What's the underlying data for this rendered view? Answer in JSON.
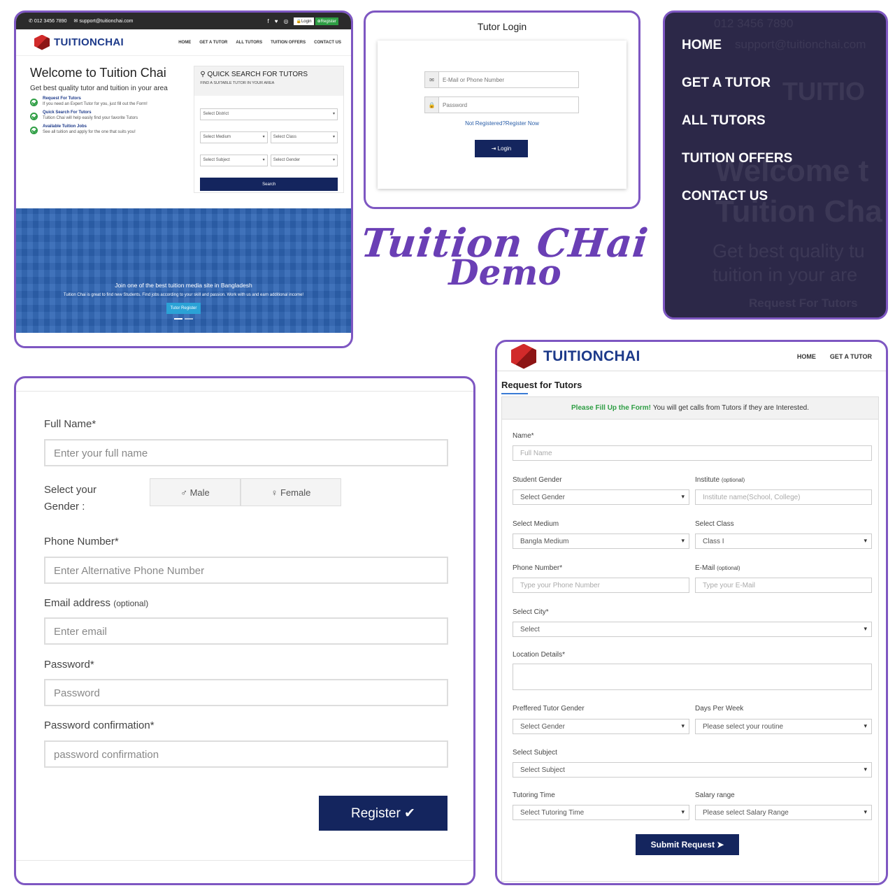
{
  "home": {
    "phone": "012 3456 7890",
    "email": "support@tuitionchai.com",
    "social": [
      "f",
      "♥",
      "◎"
    ],
    "login": "Login",
    "register": "Register",
    "brand": "TUITIONCHAI",
    "nav": [
      "HOME",
      "GET A TUTOR",
      "ALL TUTORS",
      "TUITION OFFERS",
      "CONTACT US"
    ],
    "title": "Welcome to Tuition Chai",
    "subtitle": "Get best quality tutor and tuition in your area",
    "features": [
      {
        "title": "Request For Tutors",
        "desc": "If you need an Expert Tutor for you, just fill out the Form!"
      },
      {
        "title": "Quick Search For Tutors",
        "desc": "Tuition Chai will help easily find your favorite Tutors"
      },
      {
        "title": "Available Tuition Jobs",
        "desc": "See all tuition and apply for the one that suits you!"
      }
    ],
    "quick_search": {
      "title": "QUICK SEARCH FOR TUTORS",
      "subtitle": "FIND A SUITABLE TUTOR IN YOUR AREA",
      "district": "Select District",
      "medium": "Select Medium",
      "class": "Select Class",
      "subject": "Select Subject",
      "gender": "Select Gender",
      "button": "Search"
    },
    "banner": {
      "title": "Join one of the best tuition media site in Bangladesh",
      "desc": "Tuition Chai is great to find new Students. Find jobs according to your skill and passion. Work with us and earn additional income!",
      "button": "Tutor Register"
    }
  },
  "login": {
    "title": "Tutor Login",
    "email_placeholder": "E-Mail or Phone Number",
    "password_placeholder": "Password",
    "register_link": "Not Registered?Register Now",
    "button": "Login"
  },
  "menu": {
    "items": [
      "HOME",
      "GET A TUTOR",
      "ALL TUTORS",
      "TUITION OFFERS",
      "CONTACT US"
    ],
    "ghost_phone": "012 3456 7890",
    "ghost_email": "support@tuitionchai.com",
    "ghost_brand": "TUITIO",
    "ghost_title1": "Welcome t",
    "ghost_title2": "Tuition Cha",
    "ghost_sub1": "Get best quality tu",
    "ghost_sub2": "tuition in your are",
    "ghost_feat": "Request For Tutors"
  },
  "demo": {
    "line1": "Tuition CHai",
    "line2": "Demo"
  },
  "register": {
    "full_name_label": "Full Name*",
    "full_name_placeholder": "Enter your full name",
    "gender_label_1": "Select your",
    "gender_label_2": "Gender :",
    "male": "Male",
    "female": "Female",
    "phone_label": "Phone Number*",
    "phone_placeholder": "Enter Alternative Phone Number",
    "email_label": "Email address",
    "email_optional": "(optional)",
    "email_placeholder": "Enter email",
    "password_label": "Password*",
    "password_placeholder": "Password",
    "confirm_label": "Password confirmation*",
    "confirm_placeholder": "password confirmation",
    "button": "Register ✔"
  },
  "request": {
    "brand": "TUITIONCHAI",
    "nav": [
      "HOME",
      "GET A TUTOR"
    ],
    "heading": "Request for Tutors",
    "note_bold": "Please Fill Up the Form!",
    "note": "You will get calls from Tutors if they are Interested.",
    "name_label": "Name*",
    "name_placeholder": "Full Name",
    "student_gender_label": "Student Gender",
    "student_gender": "Select Gender",
    "institute_label": "Institute",
    "institute_optional": "(optional)",
    "institute_placeholder": "Institute name(School, College)",
    "medium_label": "Select Medium",
    "medium": "Bangla Medium",
    "class_label": "Select Class",
    "class": "Class I",
    "phone_label": "Phone Number*",
    "phone_placeholder": "Type your Phone Number",
    "email_label": "E-Mail",
    "email_optional": "(optional)",
    "email_placeholder": "Type your E-Mail",
    "city_label": "Select City*",
    "city": "Select",
    "location_label": "Location Details*",
    "tutor_gender_label": "Preffered Tutor Gender",
    "tutor_gender": "Select Gender",
    "days_label": "Days Per Week",
    "days": "Please select your routine",
    "subject_label": "Select Subject",
    "subject": "Select Subject",
    "time_label": "Tutoring Time",
    "time": "Select Tutoring Time",
    "salary_label": "Salary range",
    "salary": "Please select Salary Range",
    "button": "Submit Request ➤"
  },
  "colors": {
    "accent": "#7e57c2",
    "navy": "#14255e",
    "green": "#2e9e44",
    "menu_bg": "#2c2848"
  }
}
